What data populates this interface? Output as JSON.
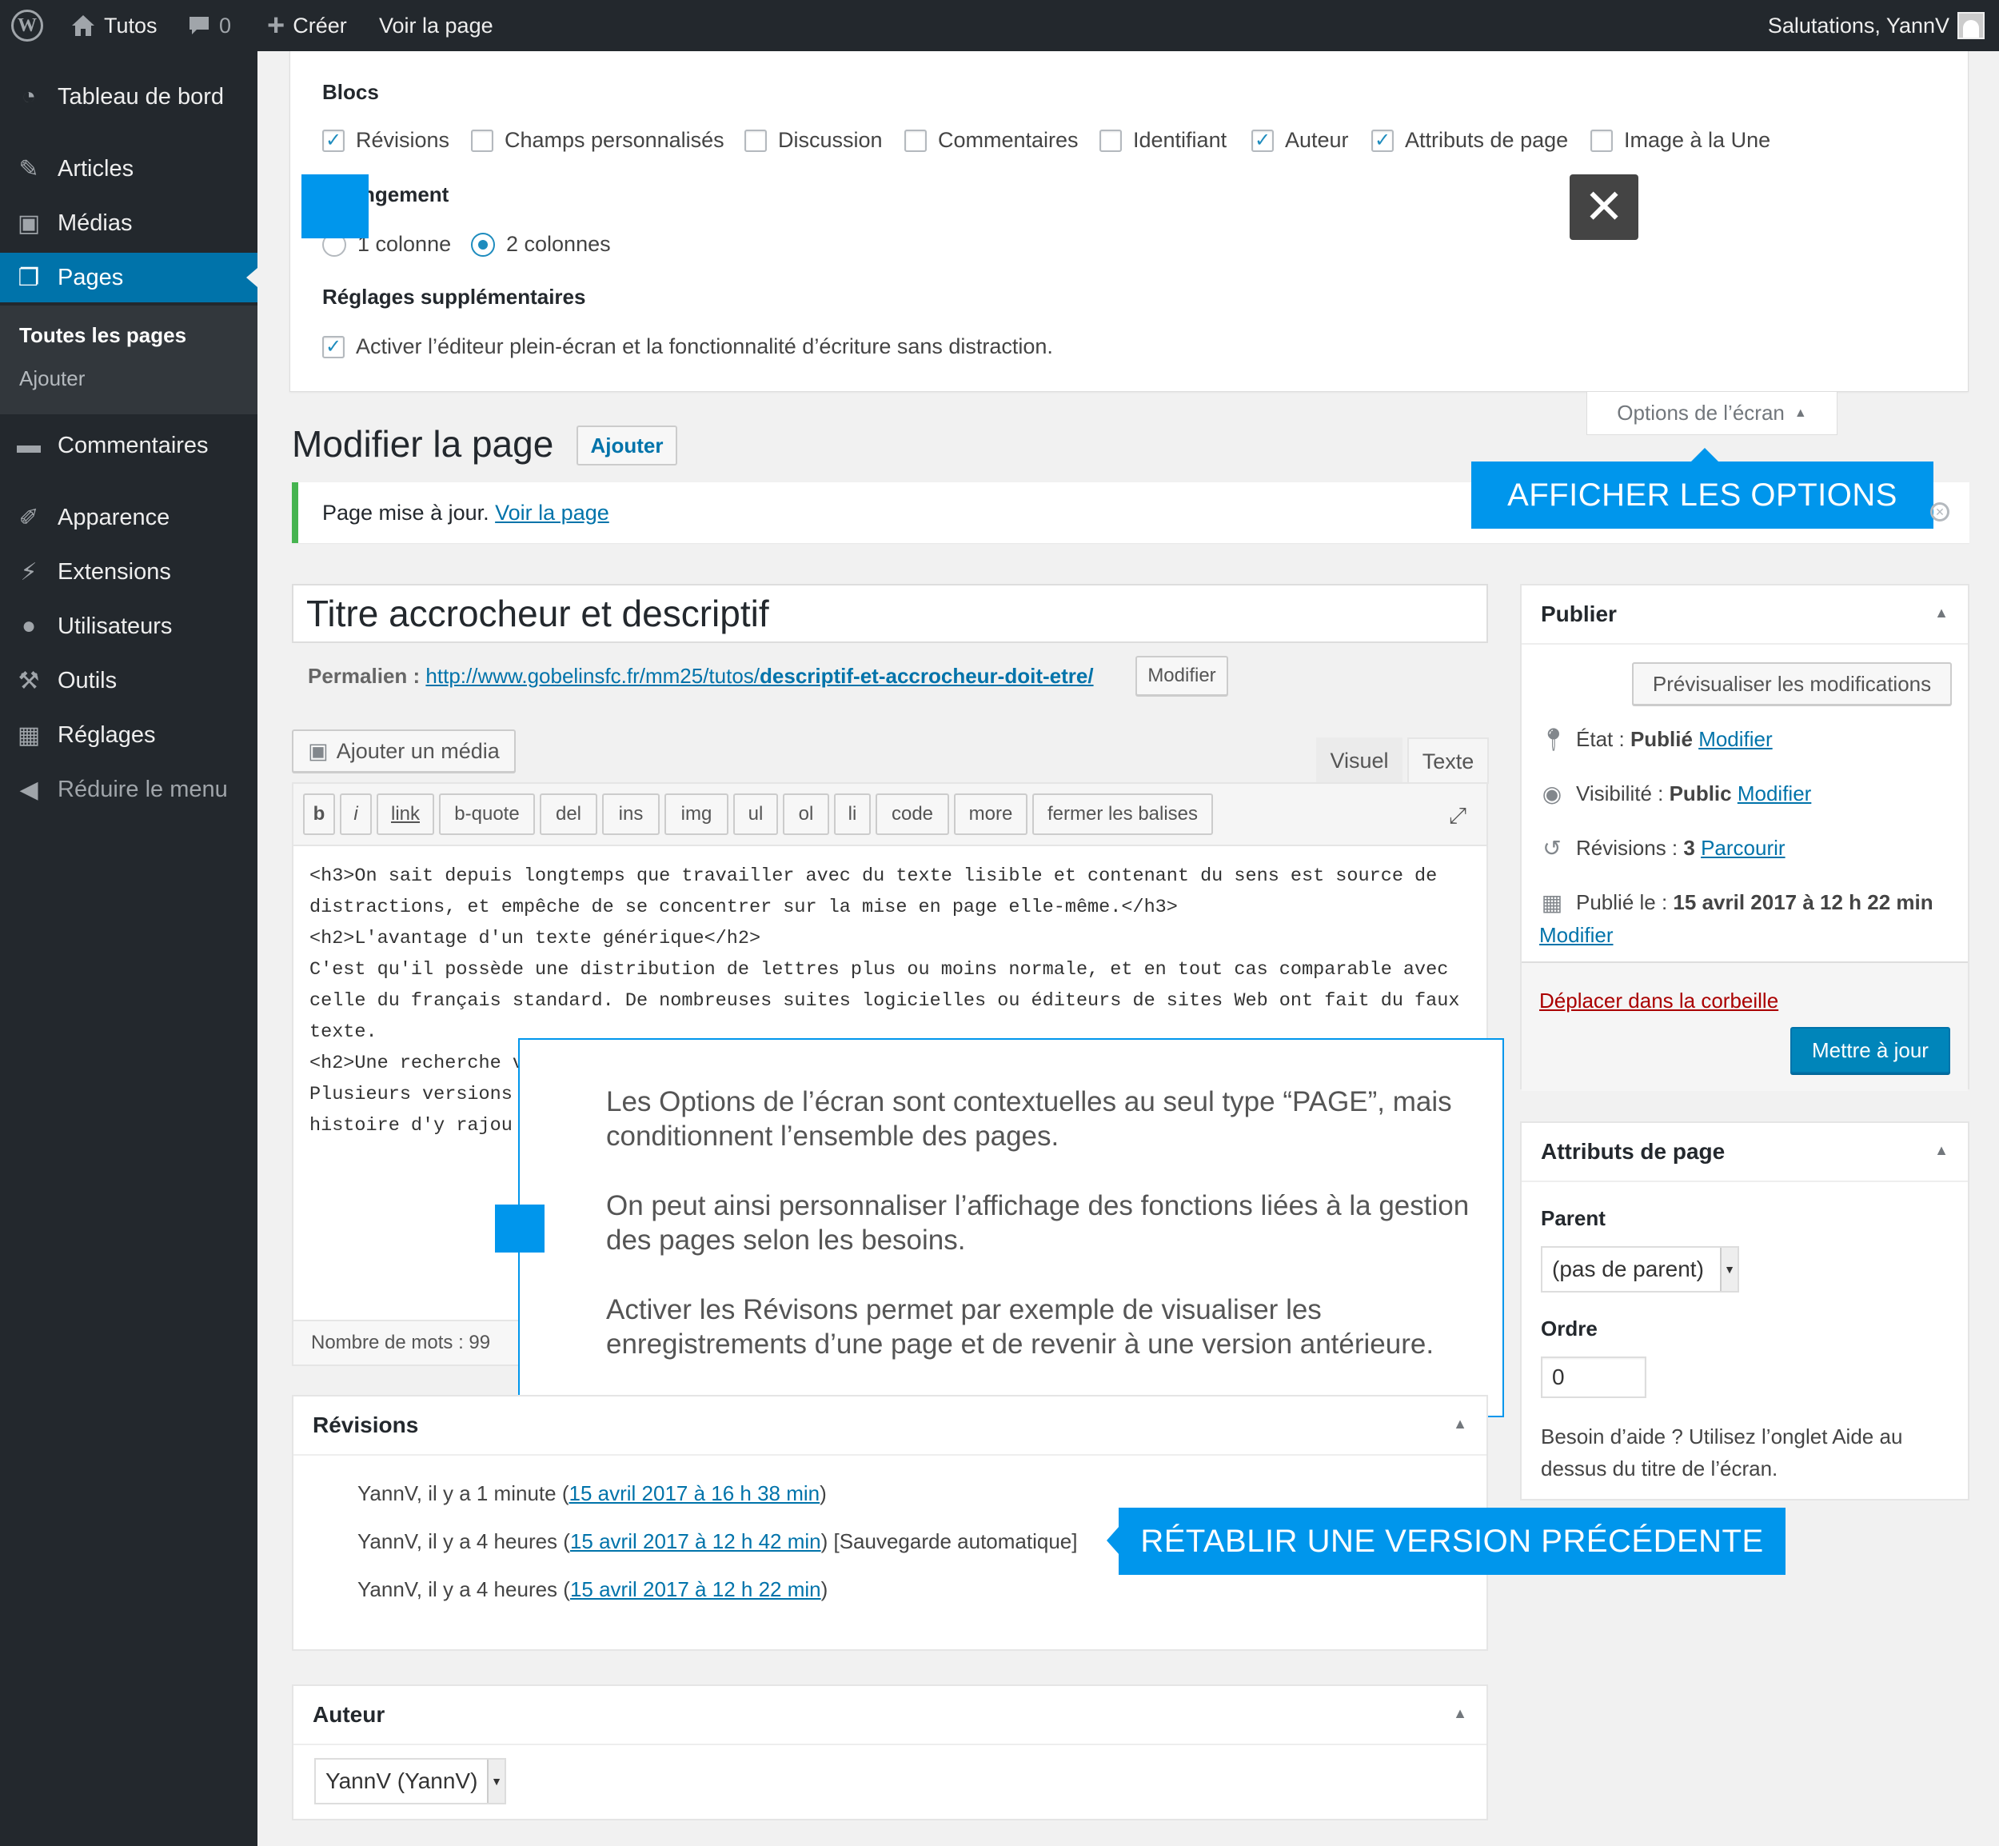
{
  "adminbar": {
    "site_name": "Tutos",
    "comments_count": "0",
    "create": "Créer",
    "view_page": "Voir la page",
    "greeting": "Salutations, YannV"
  },
  "sidebar": {
    "items": [
      {
        "label": "Tableau de bord",
        "icon": "dashboard-icon"
      },
      {
        "label": "Articles",
        "icon": "pin-icon"
      },
      {
        "label": "Médias",
        "icon": "media-icon"
      },
      {
        "label": "Pages",
        "icon": "pages-icon"
      },
      {
        "label": "Commentaires",
        "icon": "comment-icon"
      },
      {
        "label": "Apparence",
        "icon": "brush-icon"
      },
      {
        "label": "Extensions",
        "icon": "plugin-icon"
      },
      {
        "label": "Utilisateurs",
        "icon": "users-icon"
      },
      {
        "label": "Outils",
        "icon": "wrench-icon"
      },
      {
        "label": "Réglages",
        "icon": "settings-icon"
      }
    ],
    "submenu": {
      "all_pages": "Toutes les pages",
      "add": "Ajouter"
    },
    "collapse": "Réduire le menu"
  },
  "screen_options": {
    "blocks_title": "Blocs",
    "blocks": [
      {
        "label": "Révisions",
        "checked": true
      },
      {
        "label": "Champs personnalisés",
        "checked": false
      },
      {
        "label": "Discussion",
        "checked": false
      },
      {
        "label": "Commentaires",
        "checked": false
      },
      {
        "label": "Identifiant",
        "checked": false
      },
      {
        "label": "Auteur",
        "checked": true
      },
      {
        "label": "Attributs de page",
        "checked": true
      },
      {
        "label": "Image à la Une",
        "checked": false
      }
    ],
    "layout_title": "ngement",
    "layout_1": "1 colonne",
    "layout_2": "2 colonnes",
    "extra_title": "Réglages supplémentaires",
    "extra_option": "Activer l’éditeur plein-écran et la fonctionnalité d’écriture sans distraction.",
    "tab_label": "Options de l’écran"
  },
  "callouts": {
    "show_options": "AFFICHER LES OPTIONS",
    "restore_version": "RÉTABLIR UNE VERSION PRÉCÉDENTE"
  },
  "page": {
    "title": "Modifier la page",
    "add_button": "Ajouter",
    "notice_text": "Page mise à jour.",
    "notice_link": "Voir la page",
    "post_title": "Titre accrocheur et descriptif",
    "permalink_label": "Permalien :",
    "permalink_base": "http://www.gobelinsfc.fr/mm25/tutos/",
    "permalink_slug": "descriptif-et-accrocheur-doit-etre/",
    "permalink_edit": "Modifier"
  },
  "editor": {
    "add_media": "Ajouter un média",
    "tab_visual": "Visuel",
    "tab_text": "Texte",
    "buttons": [
      "b",
      "i",
      "link",
      "b-quote",
      "del",
      "ins",
      "img",
      "ul",
      "ol",
      "li",
      "code",
      "more",
      "fermer les balises"
    ],
    "content": "<h3>On sait depuis longtemps que travailler avec du texte lisible et contenant du sens est source de distractions, et empêche de se concentrer sur la mise en page elle-même.</h3>\n<h2>L'avantage d'un texte générique</h2>\nC'est qu'il possède une distribution de lettres plus ou moins normale, et en tout cas comparable avec celle du français standard. De nombreuses suites logicielles ou éditeurs de sites Web ont fait du faux texte.\n<h2>Une recherche v\nPlusieurs versions\nhistoire d'y rajou",
    "word_count": "Nombre de mots : 99"
  },
  "info_box": {
    "p1": "Les Options de l’écran sont contextuelles au seul type “PAGE”, mais conditionnent l’ensemble des pages.",
    "p2": "On peut ainsi personnaliser l’affichage des fonctions liées à la gestion des pages selon les besoins.",
    "p3": "Activer les Révisons permet par exemple de visualiser les enregistrements d’une page et de revenir à une version antérieure."
  },
  "revisions": {
    "title": "Révisions",
    "items": [
      {
        "prefix": "YannV, il y a 1 minute (",
        "link": "15 avril 2017 à 16 h 38 min",
        "suffix": ")"
      },
      {
        "prefix": "YannV, il y a 4 heures (",
        "link": "15 avril 2017 à 12 h 42 min",
        "suffix": ") [Sauvegarde automatique]"
      },
      {
        "prefix": "YannV, il y a 4 heures (",
        "link": "15 avril 2017 à 12 h 22 min",
        "suffix": ")"
      }
    ]
  },
  "author": {
    "title": "Auteur",
    "selected": "YannV (YannV)"
  },
  "publish": {
    "title": "Publier",
    "preview": "Prévisualiser les modifications",
    "status_label": "État :",
    "status_value": "Publié",
    "visibility_label": "Visibilité :",
    "visibility_value": "Public",
    "revisions_label": "Révisions :",
    "revisions_value": "3",
    "revisions_link": "Parcourir",
    "published_label": "Publié le :",
    "published_value": "15 avril 2017 à 12 h 22 min",
    "edit_link": "Modifier",
    "trash": "Déplacer dans la corbeille",
    "update": "Mettre à jour"
  },
  "page_attributes": {
    "title": "Attributs de page",
    "parent_label": "Parent",
    "parent_value": "(pas de parent)",
    "order_label": "Ordre",
    "order_value": "0",
    "help": "Besoin d’aide ? Utilisez l’onglet Aide au dessus du titre de l’écran."
  },
  "colors": {
    "accent": "#0073aa",
    "callout": "#0096ec",
    "sidebar": "#23282d",
    "notice": "#46b450"
  }
}
